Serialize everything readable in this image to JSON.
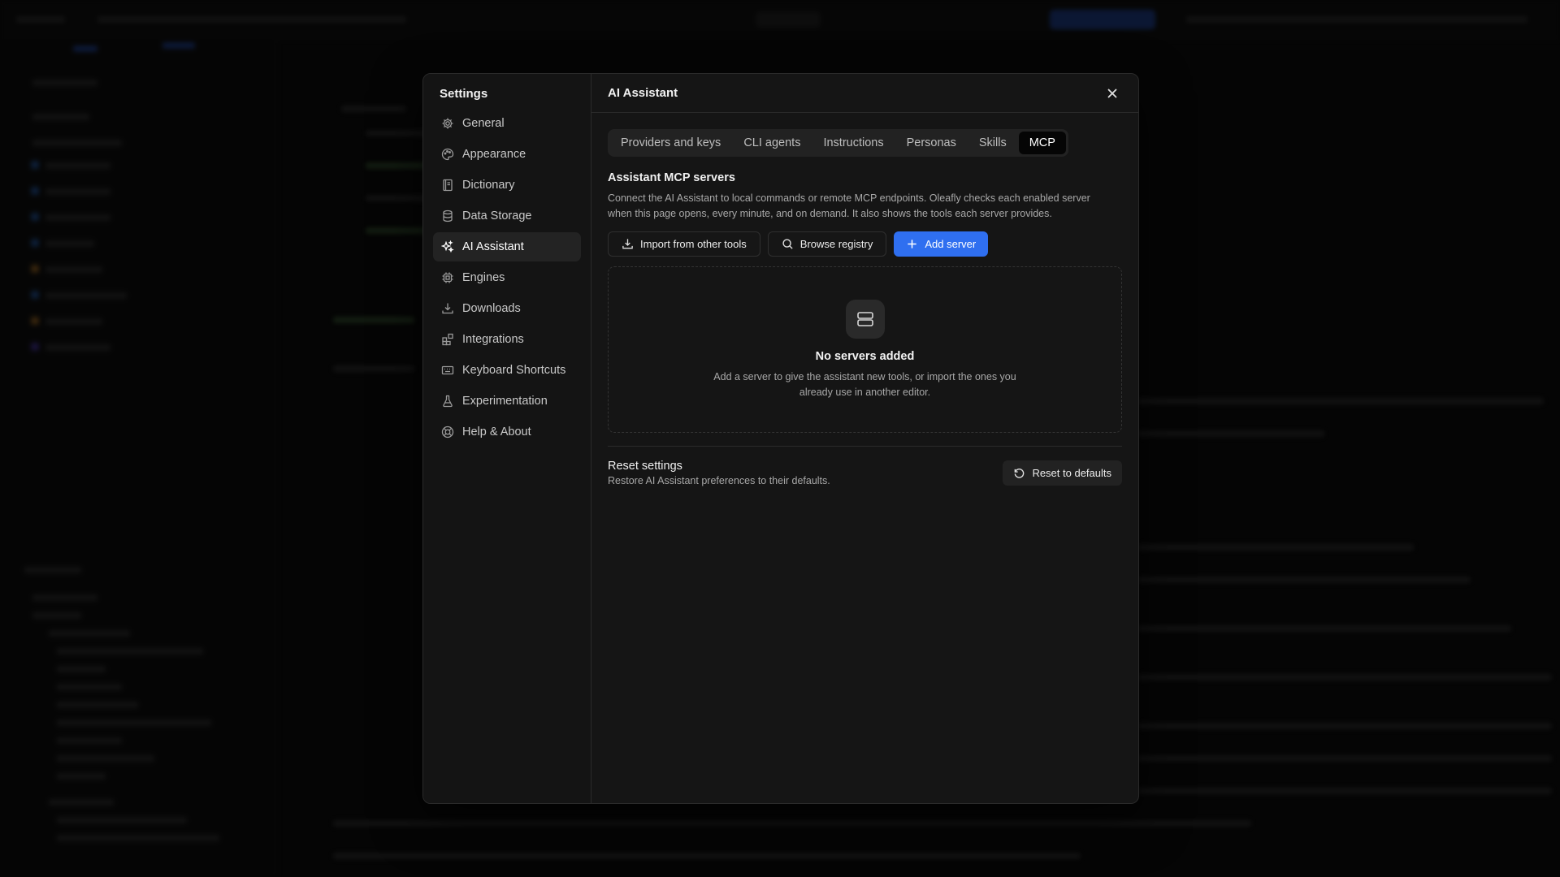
{
  "settings_nav": {
    "title": "Settings",
    "items": [
      {
        "label": "General",
        "icon": "gear-icon"
      },
      {
        "label": "Appearance",
        "icon": "palette-icon"
      },
      {
        "label": "Dictionary",
        "icon": "book-icon"
      },
      {
        "label": "Data Storage",
        "icon": "database-icon"
      },
      {
        "label": "AI Assistant",
        "icon": "sparkles-icon",
        "active": true
      },
      {
        "label": "Engines",
        "icon": "chip-icon"
      },
      {
        "label": "Downloads",
        "icon": "download-tray-icon"
      },
      {
        "label": "Integrations",
        "icon": "blocks-icon"
      },
      {
        "label": "Keyboard Shortcuts",
        "icon": "keyboard-icon"
      },
      {
        "label": "Experimentation",
        "icon": "flask-icon"
      },
      {
        "label": "Help & About",
        "icon": "lifebuoy-icon"
      }
    ]
  },
  "panel": {
    "title": "AI Assistant",
    "tabs": [
      {
        "label": "Providers and keys"
      },
      {
        "label": "CLI agents"
      },
      {
        "label": "Instructions"
      },
      {
        "label": "Personas"
      },
      {
        "label": "Skills"
      },
      {
        "label": "MCP",
        "active": true
      }
    ],
    "mcp": {
      "heading": "Assistant MCP servers",
      "description": "Connect the AI Assistant to local commands or remote MCP endpoints. Oleafly checks each enabled server when this page opens, every minute, and on demand. It also shows the tools each server provides.",
      "import_label": "Import from other tools",
      "browse_label": "Browse registry",
      "add_label": "Add server",
      "empty_title": "No servers added",
      "empty_desc": "Add a server to give the assistant new tools, or import the ones you already use in another editor."
    },
    "reset": {
      "title": "Reset settings",
      "desc": "Restore AI Assistant preferences to their defaults.",
      "button": "Reset to defaults"
    }
  },
  "colors": {
    "accent": "#2f6ff0",
    "dialog_bg": "#151515",
    "active_item": "#232323"
  }
}
